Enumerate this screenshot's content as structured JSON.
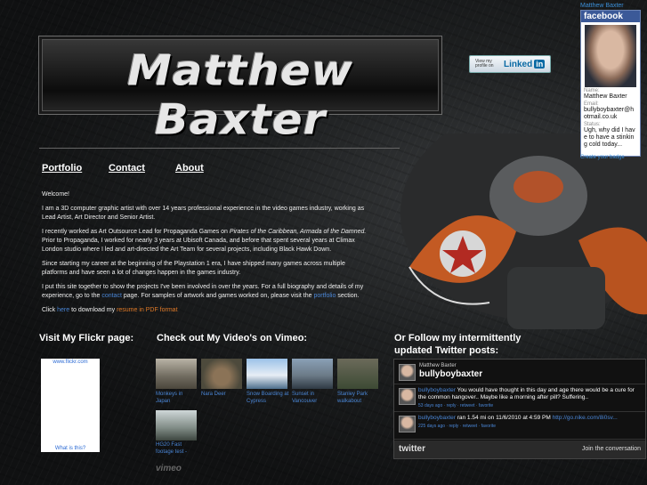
{
  "colors": {
    "link": "#4a86d6",
    "accent_orange": "#e07a28",
    "facebook_blue": "#3b5998"
  },
  "logo": {
    "text": "Matthew Baxter"
  },
  "linkedin": {
    "small": "View my profile on",
    "word": "Linked",
    "in": "in"
  },
  "facebook": {
    "top_name": "Matthew Baxter",
    "header": "facebook",
    "name_label": "Name:",
    "name": "Matthew Baxter",
    "email_label": "Email:",
    "email": "bullyboybaxter@hotmail.co.uk",
    "status_label": "Status:",
    "status": "Ugh, why did I have to have a stinking cold today...",
    "edit_link": "Create your badge"
  },
  "nav": {
    "portfolio": "Portfolio",
    "contact": "Contact",
    "about": "About"
  },
  "content": {
    "welcome": "Welcome!",
    "p1": "I am a 3D computer graphic artist with over 14 years professional experience in the video games industry, working as Lead Artist, Art Director and Senior Artist.",
    "p2_a": "I recently worked as Art Outsource Lead for Propaganda Games on ",
    "p2_italic": "Pirates of the Caribbean, Armada of the Damned.",
    "p2_b": " Prior to Propaganda, I worked for nearly 3 years at Ubisoft Canada, and before that spent several years at Climax London studio where I led and art-directed the Art Team for several projects, including Black Hawk Down.",
    "p3": "Since starting my career at the beginning of the Playstation 1 era, I have shipped many games across multiple platforms and have seen a lot of changes happen in the games industry.",
    "p4_a": "I put this site together to show the projects I've been involved in over the years. For a full biography and details of my experience, go to the ",
    "p4_link1": "contact",
    "p4_b": " page. For samples of artwork and games worked on, please visit the ",
    "p4_link2": "portfolio",
    "p4_c": " section.",
    "p5_a": "Click ",
    "p5_link1": "here",
    "p5_b": " to download my ",
    "p5_link2": "resume in PDF format"
  },
  "flickr": {
    "title": "Visit My Flickr page:",
    "brand": "www.flickr.com",
    "what": "What is this?"
  },
  "vimeo": {
    "title": "Check out My Video's on Vimeo:",
    "videos": [
      {
        "caption": "Monkeys in Japan"
      },
      {
        "caption": "Nara Deer"
      },
      {
        "caption": "Snow Boarding at Cypress"
      },
      {
        "caption": "Sunset in Vancouver"
      },
      {
        "caption": "Stanley Park walkabout"
      },
      {
        "caption": "HG20 Fast footage test -"
      }
    ],
    "logo": "vimeo"
  },
  "twitter": {
    "title_line1": "Or Follow my intermittently",
    "title_line2": "updated Twitter posts:",
    "name": "Matthew Baxter",
    "user": "bullyboybaxter",
    "tweets": [
      {
        "user": "bullyboybaxter",
        "text": " You would have thought in this day and age there would be a cure for the common hangover.. Maybe like a morning after pill? Suffering..",
        "meta": "53 days ago · reply · retweet · favorite"
      },
      {
        "user": "bullyboybaxter",
        "text": " ran 1.54 mi on 11/6/2010 at 4:59 PM ",
        "link": "http://go.nike.com/8i0sv...",
        "meta": "225 days ago · reply · retweet · favorite"
      }
    ],
    "logo": "twitter",
    "join": "Join the conversation"
  }
}
